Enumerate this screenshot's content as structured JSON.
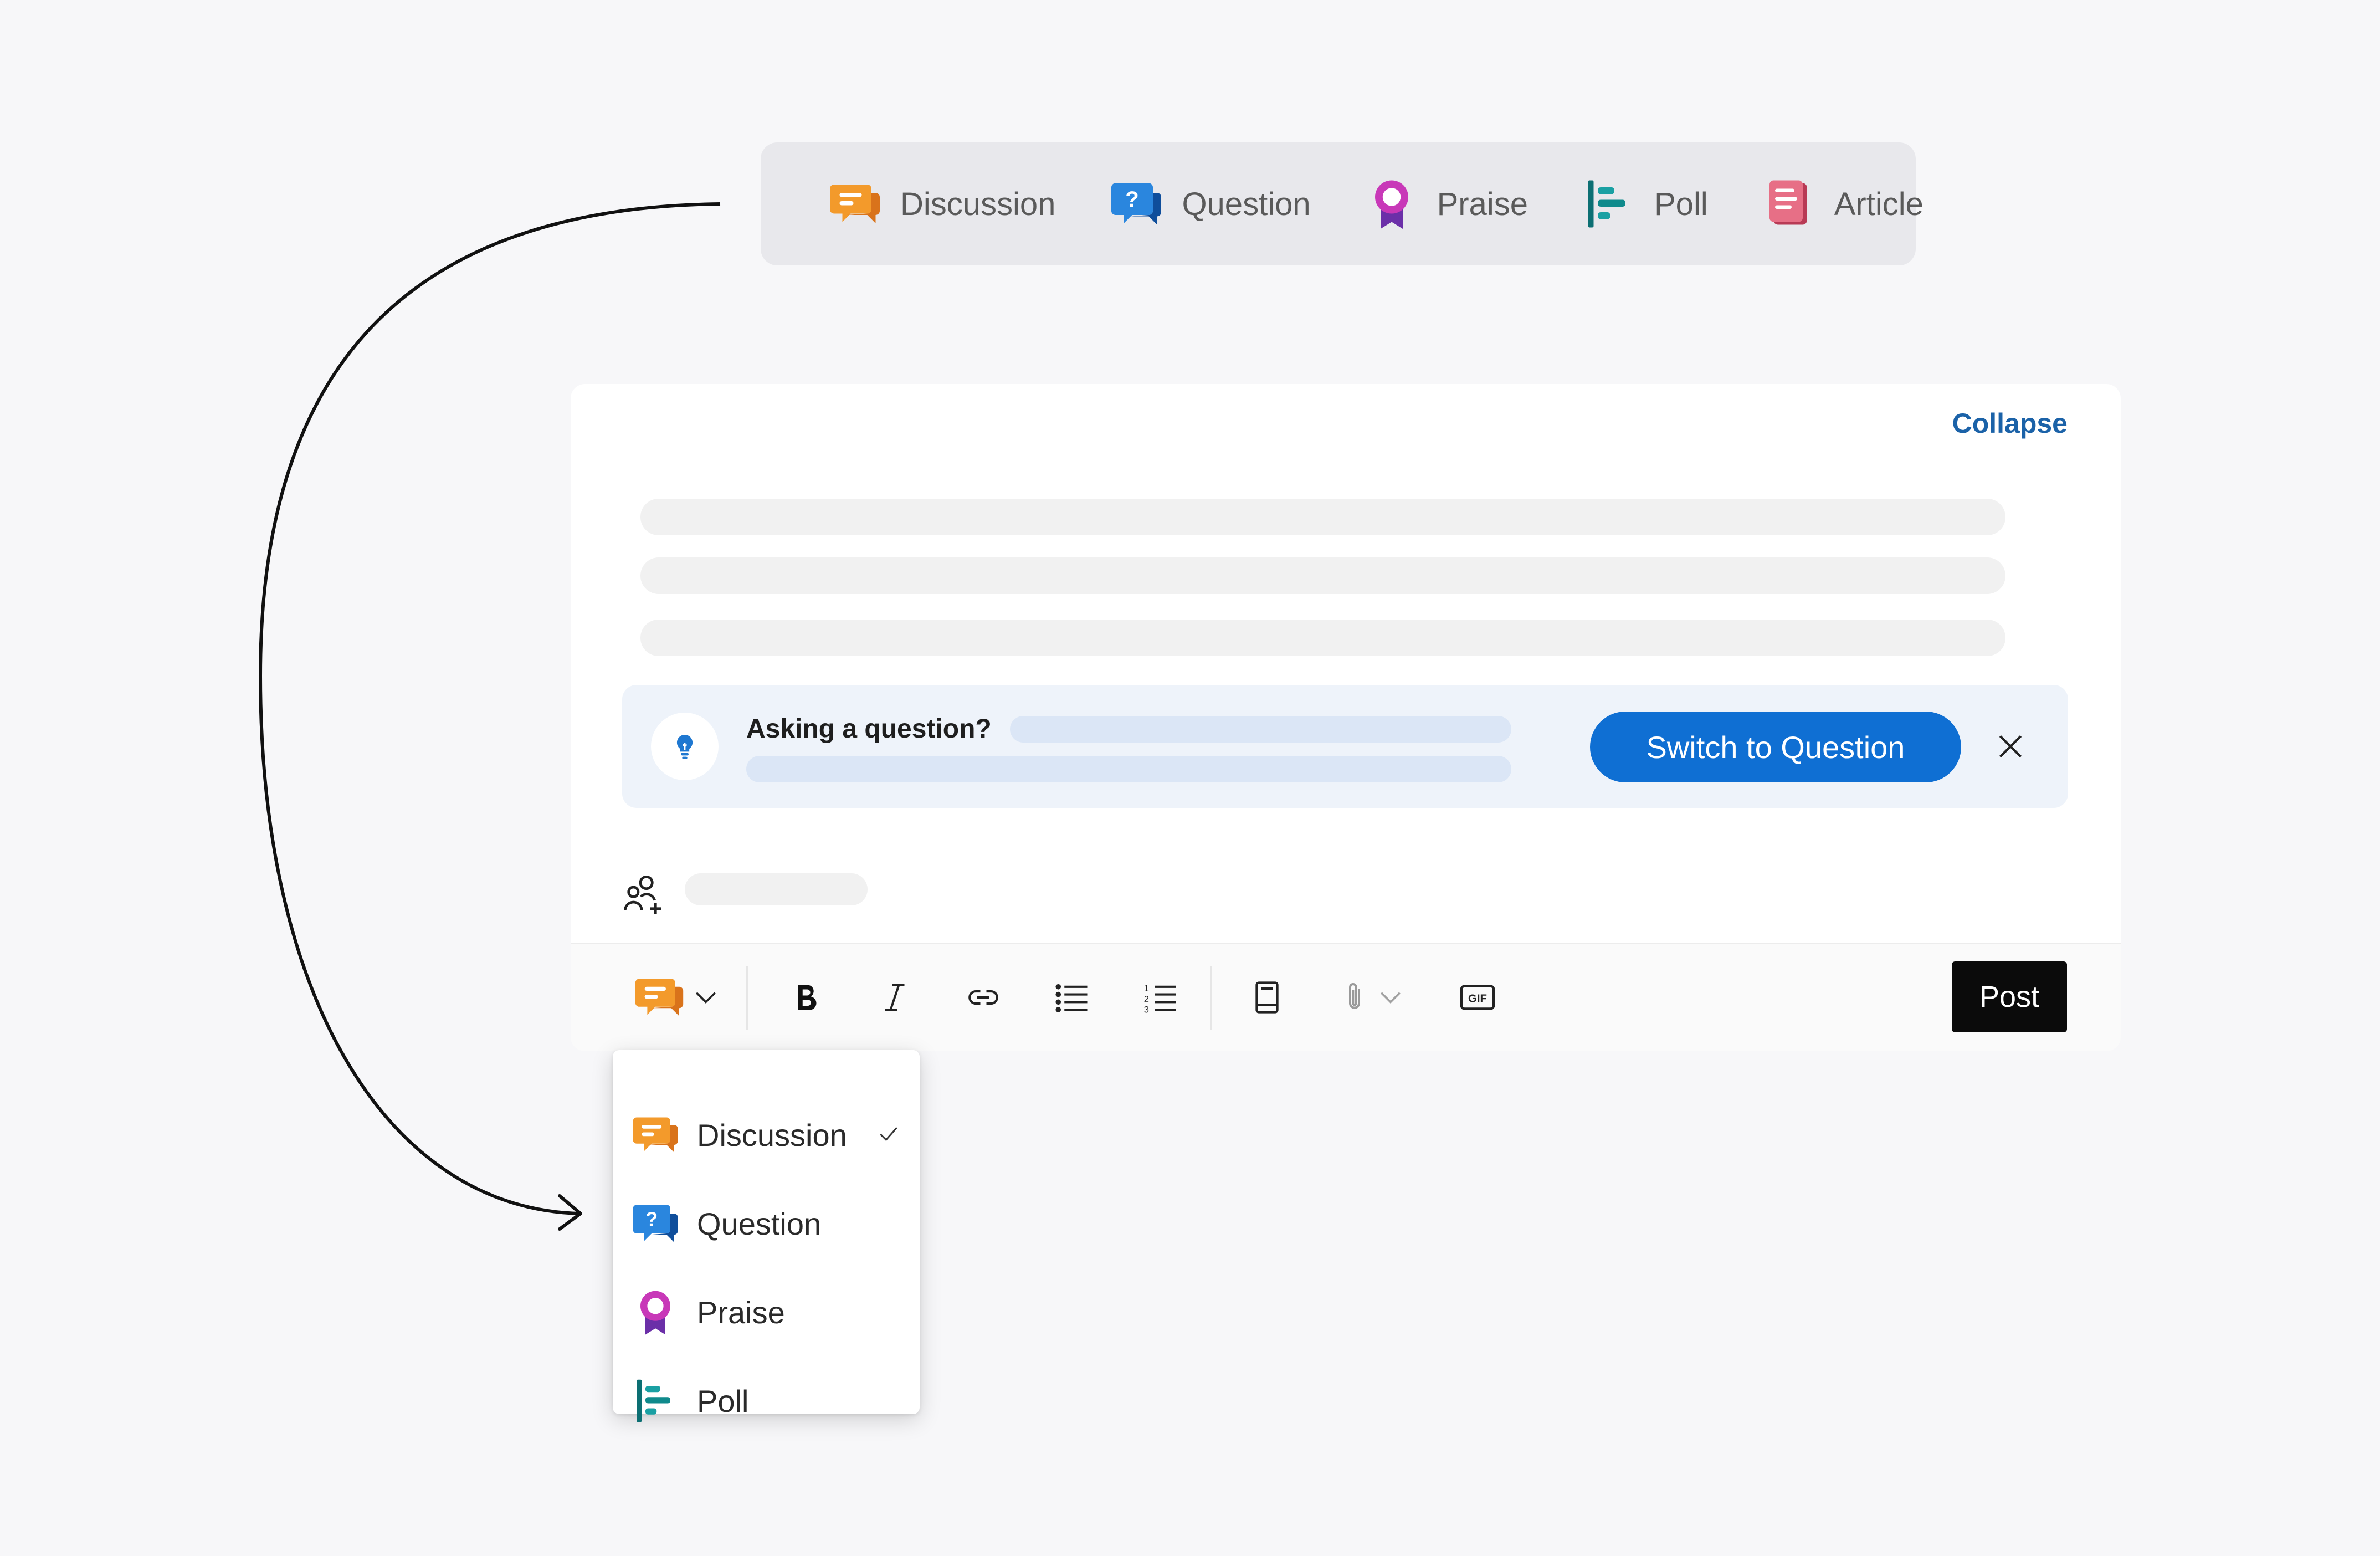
{
  "type_bar": {
    "items": [
      {
        "label": "Discussion",
        "icon": "discussion-icon"
      },
      {
        "label": "Question",
        "icon": "question-icon"
      },
      {
        "label": "Praise",
        "icon": "praise-icon"
      },
      {
        "label": "Poll",
        "icon": "poll-icon"
      },
      {
        "label": "Article",
        "icon": "article-icon"
      }
    ]
  },
  "composer": {
    "collapse_label": "Collapse",
    "suggestion": {
      "label": "Asking a question?",
      "button_label": "Switch to Question",
      "icon": "lightbulb-icon"
    },
    "toolbar": {
      "post_label": "Post",
      "icons": [
        "discussion-icon",
        "chevron-down-icon",
        "bold-icon",
        "italic-icon",
        "link-icon",
        "bulleted-list-icon",
        "numbered-list-icon",
        "book-icon",
        "attach-icon",
        "gif-icon"
      ],
      "gif_text": "GIF"
    }
  },
  "type_menu": {
    "items": [
      {
        "label": "Discussion",
        "selected": true
      },
      {
        "label": "Question",
        "selected": false
      },
      {
        "label": "Praise",
        "selected": false
      },
      {
        "label": "Poll",
        "selected": false
      }
    ]
  },
  "colors": {
    "discussion": "#f39a2b",
    "question": "#1f78d1",
    "praise": "#b833b5",
    "poll": "#0f8a8c",
    "article": "#d9506b",
    "primary_button": "#0f6fd3",
    "link": "#1b62a8"
  }
}
